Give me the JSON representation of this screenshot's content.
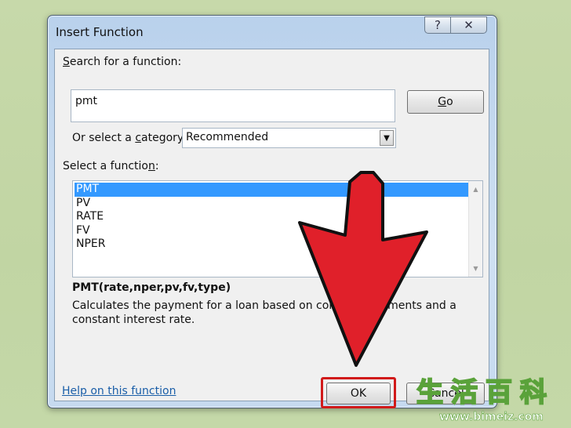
{
  "window": {
    "title": "Insert Function",
    "help_glyph": "?",
    "close_glyph": "✕"
  },
  "search": {
    "label_pre": "",
    "label_ul": "S",
    "label_post": "earch for a function:",
    "value": "pmt",
    "go_label_ul": "G",
    "go_label_post": "o"
  },
  "category": {
    "label_pre": "Or select a ",
    "label_ul": "c",
    "label_post": "ategory:",
    "selected": "Recommended",
    "arrow_glyph": "▼"
  },
  "functions": {
    "label_pre": "Select a functio",
    "label_ul": "n",
    "label_post": ":",
    "items": [
      "PMT",
      "PV",
      "RATE",
      "FV",
      "NPER"
    ],
    "selected_index": 0,
    "scroll_up_glyph": "▲",
    "scroll_down_glyph": "▼"
  },
  "detail": {
    "signature": "PMT(rate,nper,pv,fv,type)",
    "description": "Calculates the payment for a loan based on constant payments and a constant interest rate."
  },
  "footer": {
    "help_link": "Help on this function",
    "ok_label": "OK",
    "cancel_label": "Cancel"
  },
  "colors": {
    "selection": "#3399ff",
    "highlight_box": "#d11a1a",
    "arrow_fill": "#e0202a",
    "watermark_green": "#5aa23a"
  },
  "watermark": {
    "chars": [
      "生",
      "活",
      "百",
      "科"
    ],
    "url": "www.bimeiz.com"
  }
}
